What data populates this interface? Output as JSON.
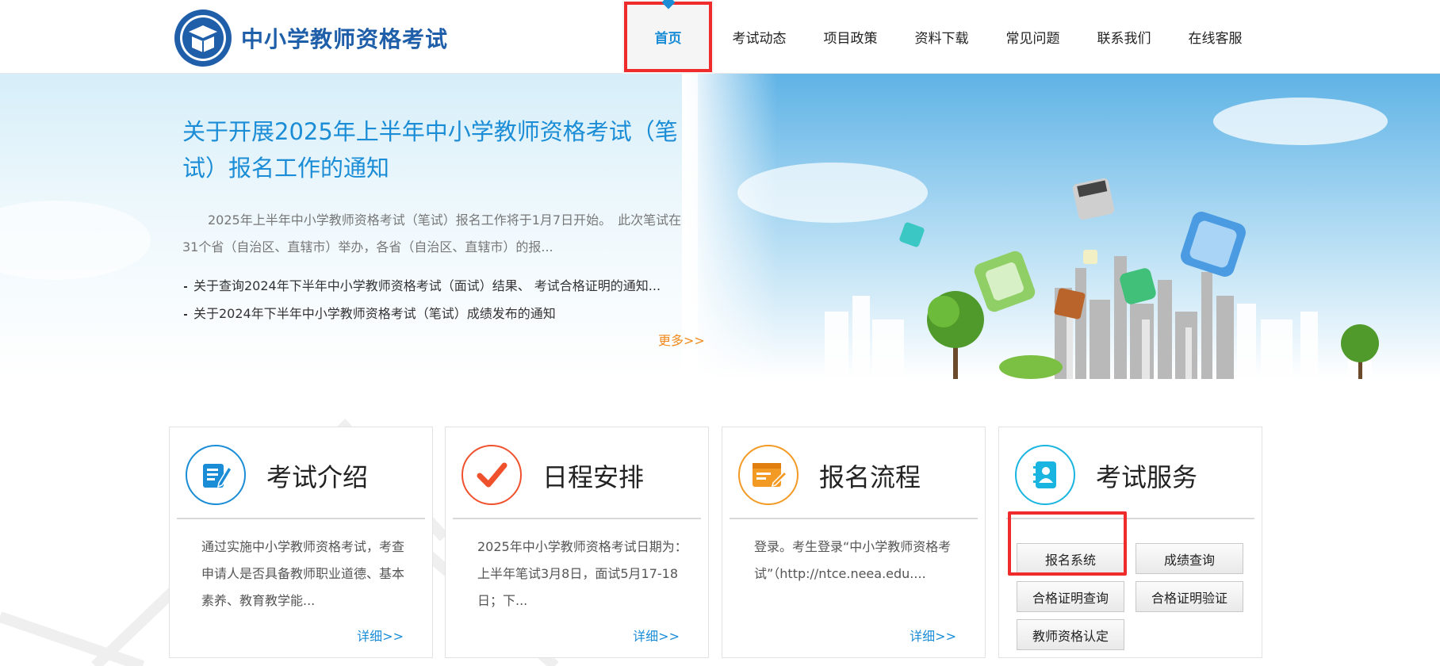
{
  "header": {
    "site_title": "中小学教师资格考试",
    "nav": [
      {
        "label": "首页",
        "active": true
      },
      {
        "label": "考试动态"
      },
      {
        "label": "项目政策"
      },
      {
        "label": "资料下载"
      },
      {
        "label": "常见问题"
      },
      {
        "label": "联系我们"
      },
      {
        "label": "在线客服"
      }
    ]
  },
  "banner": {
    "title": "关于开展2025年上半年中小学教师资格考试（笔试）报名工作的通知",
    "summary": "2025年上半年中小学教师资格考试（笔试）报名工作将于1月7日开始。　此次笔试在31个省（自治区、直辖市）举办，各省（自治区、直辖市）的报...",
    "news": [
      "关于查询2024年下半年中小学教师资格考试（面试）结果、 考试合格证明的通知...",
      "关于2024年下半年中小学教师资格考试（笔试）成绩发布的通知"
    ],
    "more": "更多>>"
  },
  "cards": {
    "intro": {
      "title": "考试介绍",
      "body": "通过实施中小学教师资格考试，考查申请人是否具备教师职业道德、基本素养、教育教学能...",
      "more": "详细>>",
      "icon": "document-edit-icon",
      "color": "#1a8dd6"
    },
    "schedule": {
      "title": "日程安排",
      "body": "2025年中小学教师资格考试日期为：上半年笔试3月8日，面试5月17-18日；下...",
      "more": "详细>>",
      "icon": "checkmark-icon",
      "color": "#f0512d"
    },
    "process": {
      "title": "报名流程",
      "body": "登录。考生登录“中小学教师资格考试”（http://ntce.neea.edu....",
      "more": "详细>>",
      "icon": "application-form-icon",
      "color": "#f39a24"
    },
    "service": {
      "title": "考试服务",
      "icon": "contact-book-icon",
      "color": "#19b5e0",
      "buttons": [
        "报名系统",
        "成绩查询",
        "合格证明查询",
        "合格证明验证",
        "教师资格认定"
      ]
    }
  }
}
